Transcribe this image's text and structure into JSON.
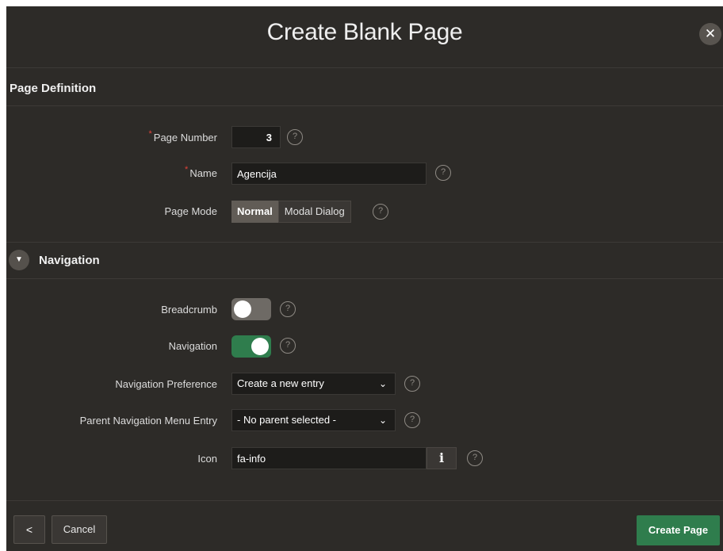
{
  "dialog": {
    "title": "Create Blank Page",
    "close_glyph": "✕"
  },
  "page_definition": {
    "title": "Page Definition",
    "required_mark": "*",
    "page_number": {
      "label": "Page Number",
      "value": "3"
    },
    "name": {
      "label": "Name",
      "value": "Agencija"
    },
    "page_mode": {
      "label": "Page Mode",
      "options": [
        "Normal",
        "Modal Dialog"
      ],
      "selected": "Normal"
    }
  },
  "navigation": {
    "title": "Navigation",
    "collapse_glyph": "▼",
    "breadcrumb": {
      "label": "Breadcrumb",
      "enabled": false
    },
    "navigation_toggle": {
      "label": "Navigation",
      "enabled": true
    },
    "navigation_preference": {
      "label": "Navigation Preference",
      "value": "Create a new entry"
    },
    "parent_entry": {
      "label": "Parent Navigation Menu Entry",
      "value": "- No parent selected -"
    },
    "icon": {
      "label": "Icon",
      "value": "fa-info",
      "picker_glyph": "i"
    }
  },
  "help_glyph": "?",
  "chevron_glyph": "⌄",
  "footer": {
    "back_glyph": "<",
    "cancel_label": "Cancel",
    "create_label": "Create Page"
  },
  "colors": {
    "background": "#2d2b28",
    "accent_green": "#2f7d4d",
    "required_red": "#e0433a"
  }
}
